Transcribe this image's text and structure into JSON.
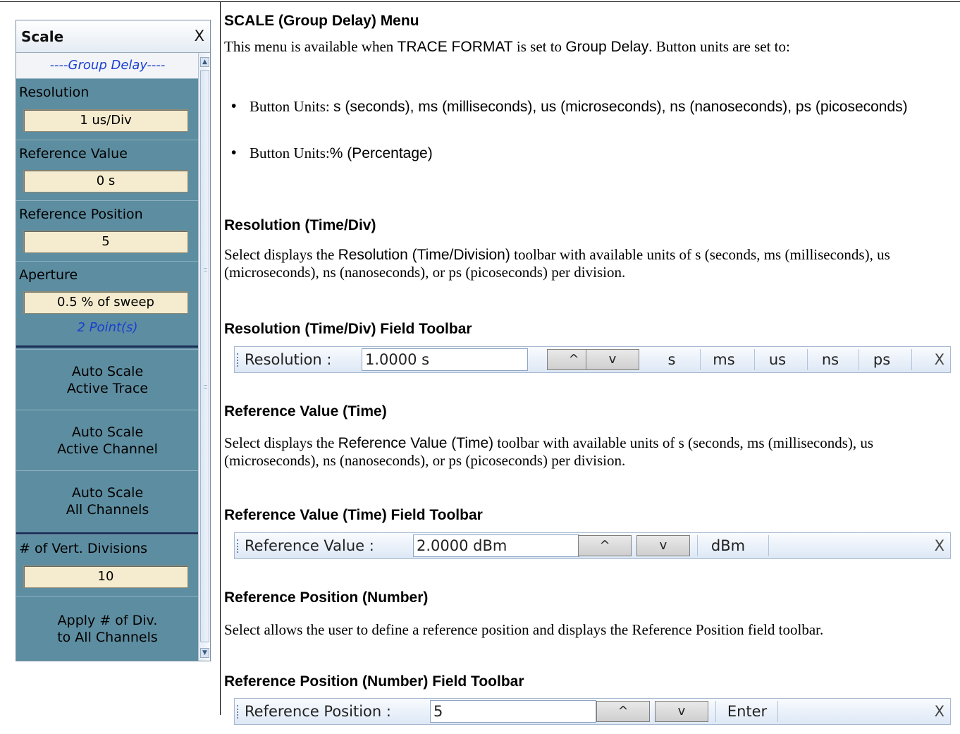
{
  "panel": {
    "title": "Scale",
    "close": "X",
    "section_header": "----Group Delay----",
    "resolution_label": "Resolution",
    "resolution_value": "1 us/Div",
    "ref_value_label": "Reference Value",
    "ref_value_value": "0  s",
    "ref_position_label": "Reference Position",
    "ref_position_value": "5",
    "aperture_label": "Aperture",
    "aperture_value": "0.5  % of sweep",
    "points": "2 Point(s)",
    "auto_scale_trace": [
      "Auto Scale",
      "Active Trace"
    ],
    "auto_scale_channel": [
      "Auto Scale",
      "Active Channel"
    ],
    "auto_scale_all": [
      "Auto Scale",
      "All Channels"
    ],
    "vert_div_label": "# of Vert. Divisions",
    "vert_div_value": "10",
    "apply_div": [
      "Apply # of Div.",
      "to All Channels"
    ]
  },
  "doc": {
    "menu_title": "SCALE (Group Delay) Menu",
    "intro_1": "This menu is available when ",
    "intro_trace_format": "TRACE FORMAT",
    "intro_2": " is set to ",
    "intro_group_delay": "Group Delay",
    "intro_3": ". Button units are set to:",
    "bullet1_a": "Button Units: ",
    "bullet1_b": "s (seconds), ms (milliseconds), us (microseconds), ns (nanoseconds), ps (picoseconds)",
    "bullet2_a": "Button Units:",
    "bullet2_b": "% (Percentage)",
    "res_heading": "Resolution (Time/Div)",
    "res_p1": "Select displays the ",
    "res_p_ui": "Resolution (Time/Division)",
    "res_p2": " toolbar with available units of s (seconds, ms (milliseconds), us (microseconds), ns (nanoseconds), or ps (picoseconds) per division.",
    "res_toolbar_heading": "Resolution (Time/Div) Field Toolbar",
    "refval_heading": "Reference Value (Time)",
    "refval_p1": "Select displays the ",
    "refval_p_ui": "Reference Value (Time)",
    "refval_p2": " toolbar with available units of s (seconds, ms (milliseconds), us (microseconds), ns (nanoseconds), or ps (picoseconds) per division.",
    "refval_toolbar_heading": "Reference Value (Time) Field Toolbar",
    "refpos_heading": "Reference Position (Number)",
    "refpos_p": "Select allows the user to define a reference position and displays the Reference Position field toolbar.",
    "refpos_toolbar_heading": "Reference Position (Number) Field Toolbar"
  },
  "toolbars": {
    "resolution": {
      "name": "Resolution  :",
      "value": "1.0000  s",
      "units": [
        "s",
        "ms",
        "us",
        "ns",
        "ps"
      ],
      "close": "X"
    },
    "ref_value": {
      "name": "Reference Value  :",
      "value": "2.0000  dBm",
      "units": [
        "dBm"
      ],
      "close": "X"
    },
    "ref_position": {
      "name": "Reference Position  :",
      "value": "5",
      "units": [
        "Enter"
      ],
      "close": "X"
    },
    "up_glyph": "^",
    "down_glyph": "v"
  }
}
